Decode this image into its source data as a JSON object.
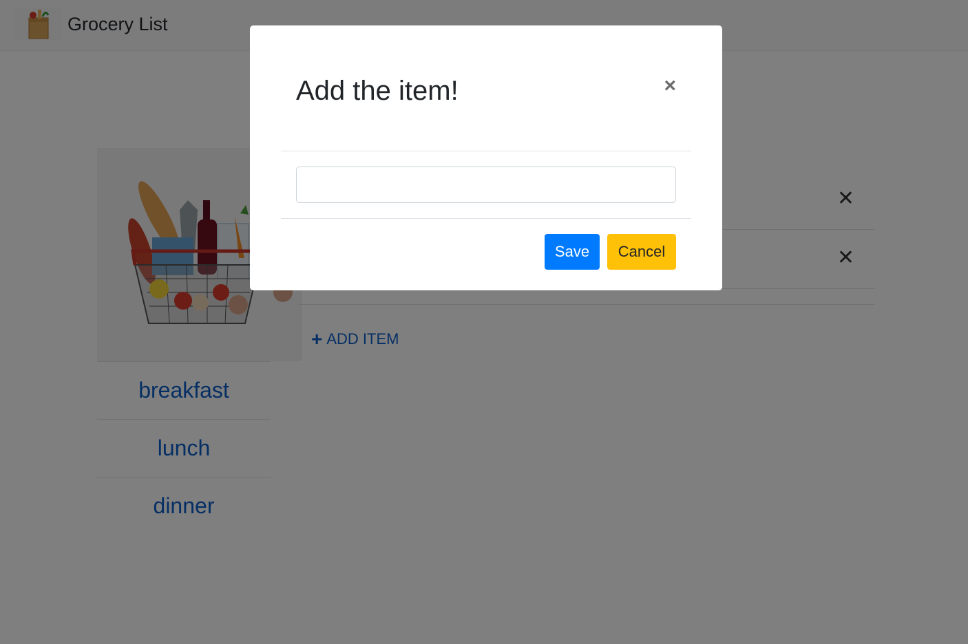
{
  "navbar": {
    "title": "Grocery List",
    "logo_icon": "grocery-bag-icon"
  },
  "sidebar": {
    "image_icon": "grocery-basket-icon",
    "items": [
      {
        "label": "breakfast"
      },
      {
        "label": "lunch"
      },
      {
        "label": "dinner"
      }
    ]
  },
  "items_list": {
    "remove_symbol": "✕",
    "add_item_label": "ADD ITEM",
    "add_icon": "+"
  },
  "modal": {
    "title": "Add the item!",
    "close_symbol": "×",
    "input_value": "",
    "input_placeholder": "",
    "save_label": "Save",
    "cancel_label": "Cancel"
  },
  "colors": {
    "primary": "#007bff",
    "warning": "#ffc107",
    "link": "#0b5fc8",
    "backdrop": "#000000"
  }
}
